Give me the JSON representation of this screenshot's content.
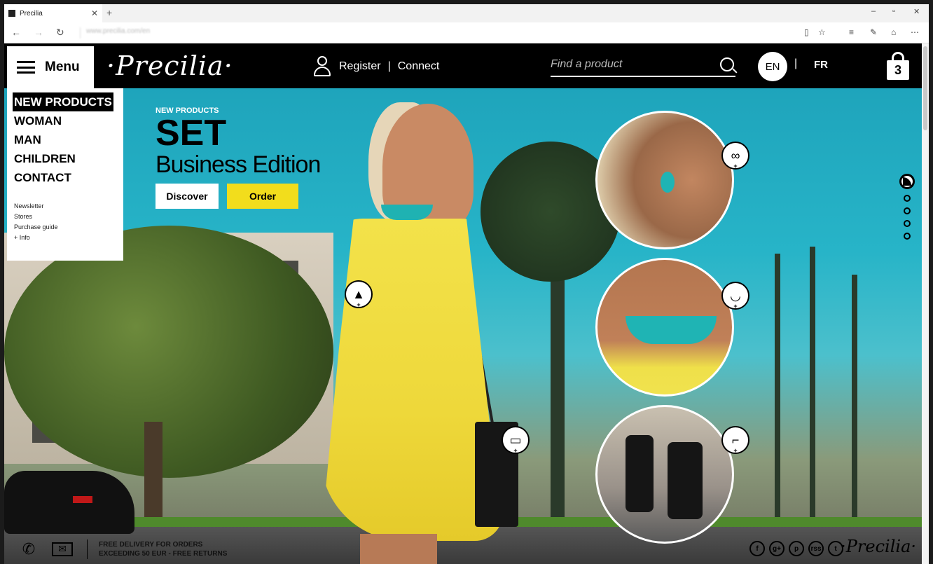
{
  "browser": {
    "tab_title": "Precilia",
    "tab_close": "✕",
    "new_tab": "+",
    "window_controls": [
      "–",
      "▫",
      "✕"
    ],
    "address": "www.precilia.com/en",
    "toolbar_icons": [
      "reading-view-icon",
      "favorites-star-icon",
      "hub-icon",
      "web-note-icon",
      "share-icon",
      "more-icon"
    ]
  },
  "header": {
    "menu_label": "Menu",
    "logo": "·Precilia·",
    "register": "Register",
    "account_sep": "|",
    "connect": "Connect",
    "search_placeholder": "Find a product",
    "lang_en": "EN",
    "lang_sep": "|",
    "lang_fr": "FR",
    "cart_count": "3"
  },
  "menu": {
    "items": [
      "NEW PRODUCTS",
      "WOMAN",
      "MAN",
      "CHILDREN",
      "CONTACT"
    ],
    "secondary": [
      "Newsletter",
      "Stores",
      "Purchase guide",
      "+ Info"
    ]
  },
  "hero": {
    "kicker": "NEW PRODUCTS",
    "title": "SET",
    "subtitle": "Business Edition",
    "discover": "Discover",
    "order": "Order"
  },
  "zoom_badges": [
    "earrings-icon",
    "necklace-icon",
    "shoe-icon"
  ],
  "product_badges": [
    "dress-icon",
    "handbag-icon"
  ],
  "footer": {
    "delivery_line1": "FREE DELIVERY FOR ORDERS",
    "delivery_line2": "EXCEEDING 50 EUR - FREE RETURNS",
    "socials": [
      "f",
      "g+",
      "p",
      "rss",
      "t"
    ],
    "logo": "·Precilia·"
  },
  "colors": {
    "header_bg": "#000000",
    "order_button": "#f2dd1c",
    "sky": "#1ca0b8"
  }
}
